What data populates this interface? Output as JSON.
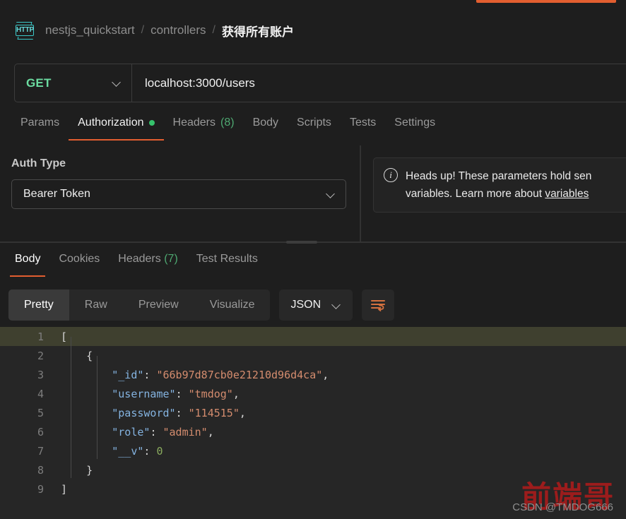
{
  "window": {
    "active_tab_accent": "#e25e30"
  },
  "breadcrumb": {
    "icon": "http-protocol-icon",
    "icon_label": "HTTP",
    "workspace": "nestjs_quickstart",
    "separator": "/",
    "folder": "controllers",
    "current": "获得所有账户"
  },
  "url_bar": {
    "method": "GET",
    "method_color": "#6bdba0",
    "url": "localhost:3000/users",
    "chevron": "chevron-down-icon"
  },
  "request_tabs": [
    {
      "label": "Params",
      "active": false,
      "badge": ""
    },
    {
      "label": "Authorization",
      "active": true,
      "badge": "dot-green"
    },
    {
      "label": "Headers",
      "active": false,
      "badge": "(8)"
    },
    {
      "label": "Body",
      "active": false,
      "badge": ""
    },
    {
      "label": "Scripts",
      "active": false,
      "badge": ""
    },
    {
      "label": "Tests",
      "active": false,
      "badge": ""
    },
    {
      "label": "Settings",
      "active": false,
      "badge": ""
    }
  ],
  "auth": {
    "type_label": "Auth Type",
    "selected": "Bearer Token",
    "chevron": "chevron-down-icon"
  },
  "info_banner": {
    "icon": "info-circle-icon",
    "line1": "Heads up! These parameters hold sen",
    "line2_prefix": "variables. Learn more about ",
    "line2_link": "variables"
  },
  "response_tabs": [
    {
      "label": "Body",
      "active": true,
      "badge": ""
    },
    {
      "label": "Cookies",
      "active": false,
      "badge": ""
    },
    {
      "label": "Headers",
      "active": false,
      "badge": "(7)"
    },
    {
      "label": "Test Results",
      "active": false,
      "badge": ""
    }
  ],
  "view_bar": {
    "segments": [
      {
        "label": "Pretty",
        "active": true
      },
      {
        "label": "Raw",
        "active": false
      },
      {
        "label": "Preview",
        "active": false
      },
      {
        "label": "Visualize",
        "active": false
      }
    ],
    "format": "JSON",
    "format_chevron": "chevron-down-icon",
    "wrap_button": "word-wrap-icon"
  },
  "response_body": {
    "language": "json",
    "highlighted_line": 1,
    "lines": [
      {
        "num": "1",
        "indent": 0,
        "tokens": [
          {
            "t": "[",
            "c": "p"
          }
        ]
      },
      {
        "num": "2",
        "indent": 1,
        "tokens": [
          {
            "t": "{",
            "c": "p"
          }
        ]
      },
      {
        "num": "3",
        "indent": 2,
        "tokens": [
          {
            "t": "\"_id\"",
            "c": "k"
          },
          {
            "t": ": ",
            "c": "p"
          },
          {
            "t": "\"66b97d87cb0e21210d96d4ca\"",
            "c": "s"
          },
          {
            "t": ",",
            "c": "p"
          }
        ]
      },
      {
        "num": "4",
        "indent": 2,
        "tokens": [
          {
            "t": "\"username\"",
            "c": "k"
          },
          {
            "t": ": ",
            "c": "p"
          },
          {
            "t": "\"tmdog\"",
            "c": "s"
          },
          {
            "t": ",",
            "c": "p"
          }
        ]
      },
      {
        "num": "5",
        "indent": 2,
        "tokens": [
          {
            "t": "\"password\"",
            "c": "k"
          },
          {
            "t": ": ",
            "c": "p"
          },
          {
            "t": "\"114515\"",
            "c": "s"
          },
          {
            "t": ",",
            "c": "p"
          }
        ]
      },
      {
        "num": "6",
        "indent": 2,
        "tokens": [
          {
            "t": "\"role\"",
            "c": "k"
          },
          {
            "t": ": ",
            "c": "p"
          },
          {
            "t": "\"admin\"",
            "c": "s"
          },
          {
            "t": ",",
            "c": "p"
          }
        ]
      },
      {
        "num": "7",
        "indent": 2,
        "tokens": [
          {
            "t": "\"__v\"",
            "c": "k"
          },
          {
            "t": ": ",
            "c": "p"
          },
          {
            "t": "0",
            "c": "n"
          }
        ]
      },
      {
        "num": "8",
        "indent": 1,
        "tokens": [
          {
            "t": "}",
            "c": "p"
          }
        ]
      },
      {
        "num": "9",
        "indent": 0,
        "tokens": [
          {
            "t": "]",
            "c": "p"
          }
        ]
      }
    ]
  },
  "watermark": {
    "main": "前端哥",
    "sub": "CSDN @TMDOG666"
  }
}
